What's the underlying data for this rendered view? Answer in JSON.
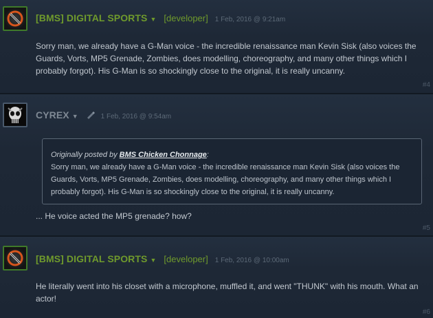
{
  "posts": [
    {
      "author": "[BMS] DIGITAL SPORTS",
      "tag": "[developer]",
      "date": "1 Feb, 2016 @ 9:21am",
      "text": "Sorry man, we already have a G-Man voice - the incredible renaissance man Kevin Sisk (also voices the Guards, Vorts, MP5 Grenade, Zombies, does modelling, choreography, and many other things which I probably forgot). His G-Man is so shockingly close to the original, it is really uncanny.",
      "number": "#4",
      "avatar_icon": "developer-logo-icon"
    },
    {
      "author": "CYREX",
      "date": "1 Feb, 2016 @ 9:54am",
      "quote": {
        "prefix": "Originally posted by ",
        "author": "BMS Chicken Chonnage",
        "suffix": ":",
        "text": "Sorry man, we already have a G-Man voice - the incredible renaissance man Kevin Sisk (also voices the Guards, Vorts, MP5 Grenade, Zombies, does modelling, choreography, and many other things which I probably forgot). His G-Man is so shockingly close to the original, it is really uncanny."
      },
      "text": "... He voice acted the MP5 grenade? how?",
      "number": "#5",
      "avatar_icon": "skull-avatar-icon"
    },
    {
      "author": "[BMS] DIGITAL SPORTS",
      "tag": "[developer]",
      "date": "1 Feb, 2016 @ 10:00am",
      "text": "He literally went into his closet with a microphone, muffled it, and went \"THUNK\" with his mouth. What an actor!",
      "number": "#6",
      "avatar_icon": "developer-logo-icon"
    }
  ],
  "caret_glyph": "▼",
  "colors": {
    "developer_green": "#6f9a2c",
    "background": "#1d2837",
    "text": "#c3c9d0"
  }
}
